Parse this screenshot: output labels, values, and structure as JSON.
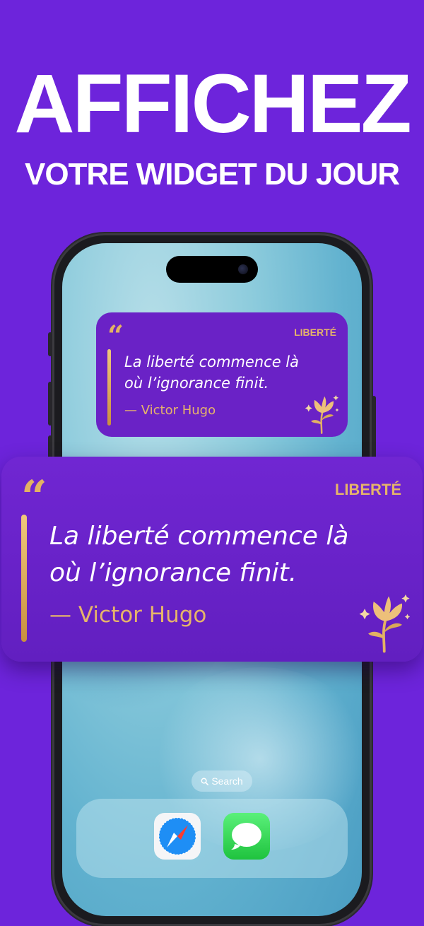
{
  "headline": "AFFICHEZ",
  "subheadline": "VOTRE WIDGET DU JOUR",
  "widget": {
    "category": "LIBERTÉ",
    "quote_line1": "La liberté commence là",
    "quote_line2": "où l’ignorance finit.",
    "author": "— Victor Hugo",
    "quote_icon": "opening-quote-icon",
    "decor_icon": "golden-flower-icon"
  },
  "homescreen": {
    "search_label": "Search",
    "dock_apps": [
      "Safari",
      "Messages"
    ]
  },
  "colors": {
    "background": "#6d24db",
    "widget": "#6a22c6",
    "accent_gold": "#e3b264"
  }
}
